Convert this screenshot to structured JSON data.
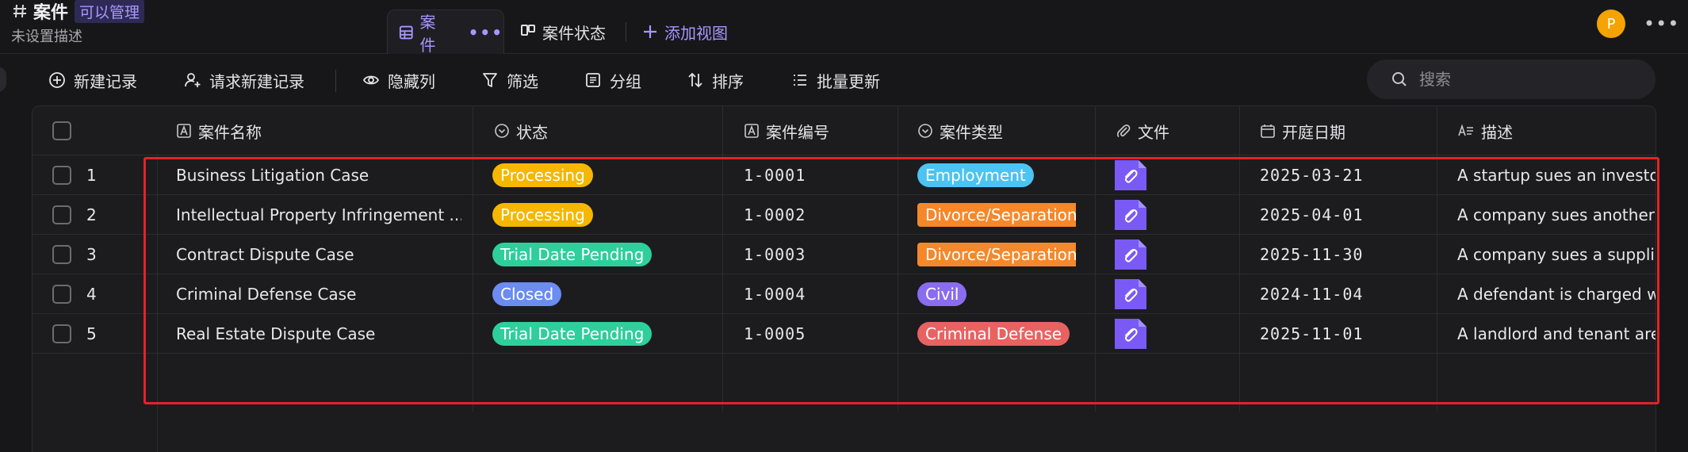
{
  "header": {
    "title": "案件",
    "badge": "可以管理",
    "subtitle": "未设置描述",
    "tabs": [
      {
        "label": "案件",
        "more": "•••"
      },
      {
        "label": "案件状态"
      },
      {
        "label": "添加视图"
      }
    ],
    "avatar_letter": "P",
    "more": "•••"
  },
  "toolbar": {
    "new_record": "新建记录",
    "request_new_record": "请求新建记录",
    "hide_columns": "隐藏列",
    "filter": "筛选",
    "group": "分组",
    "sort": "排序",
    "bulk_update": "批量更新",
    "search_placeholder": "搜索"
  },
  "table": {
    "columns": {
      "name": "案件名称",
      "status": "状态",
      "number": "案件编号",
      "type": "案件类型",
      "file": "文件",
      "date": "开庭日期",
      "description": "描述"
    },
    "rows": [
      {
        "index": "1",
        "name": "Business Litigation Case",
        "status": "Processing",
        "number": "1-0001",
        "type": "Employment",
        "date": "2025-03-21",
        "description": "A startup sues an investor"
      },
      {
        "index": "2",
        "name": "Intellectual Property Infringement ...",
        "status": "Processing",
        "number": "1-0002",
        "type": "Divorce/Separation",
        "date": "2025-04-01",
        "description": "A company sues another f"
      },
      {
        "index": "3",
        "name": "Contract Dispute Case",
        "status": "Trial Date Pending",
        "number": "1-0003",
        "type": "Divorce/Separation",
        "date": "2025-11-30",
        "description": "A company sues a supplie"
      },
      {
        "index": "4",
        "name": "Criminal Defense Case",
        "status": "Closed",
        "number": "1-0004",
        "type": "Civil",
        "date": "2024-11-04",
        "description": "A defendant is charged wi"
      },
      {
        "index": "5",
        "name": "Real Estate Dispute Case",
        "status": "Trial Date Pending",
        "number": "1-0005",
        "type": "Criminal Defense",
        "date": "2025-11-01",
        "description": "A landlord and tenant are i"
      }
    ]
  },
  "colors": {
    "accent": "#a896ff",
    "status_processing": "#f5b700",
    "status_trial_pending": "#2ecf9a",
    "status_closed": "#6b8cf0",
    "type_employment": "#4cc3f0",
    "type_divorce": "#f5882a",
    "type_civil": "#8a6cf0",
    "type_criminal": "#e86262",
    "file_icon": "#7a5af5",
    "highlight": "#e0242a"
  }
}
